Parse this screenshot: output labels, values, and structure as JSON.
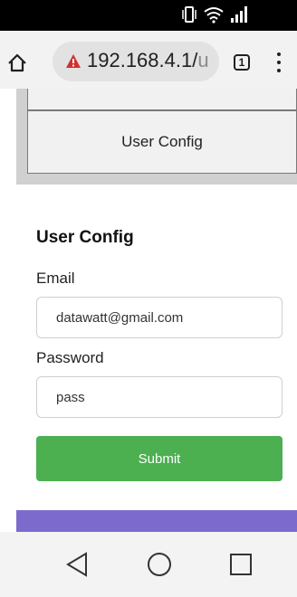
{
  "browser": {
    "url_visible": "192.168.4.1/",
    "url_faded": "u",
    "tab_count": "1"
  },
  "page": {
    "menu_item_label": "User Config",
    "form": {
      "title": "User Config",
      "email_label": "Email",
      "email_value": "datawatt@gmail.com",
      "password_label": "Password",
      "password_value": "pass",
      "submit_label": "Submit"
    }
  },
  "colors": {
    "submit_green": "#4caf50",
    "footer_purple": "#7c6bcc",
    "warning_red": "#d32f2f"
  },
  "icons": [
    "vibrate-icon",
    "wifi-icon",
    "signal-icon",
    "home-icon",
    "warning-icon",
    "tabs-icon",
    "menu-icon",
    "back-icon",
    "home-circle-icon",
    "recents-icon"
  ]
}
